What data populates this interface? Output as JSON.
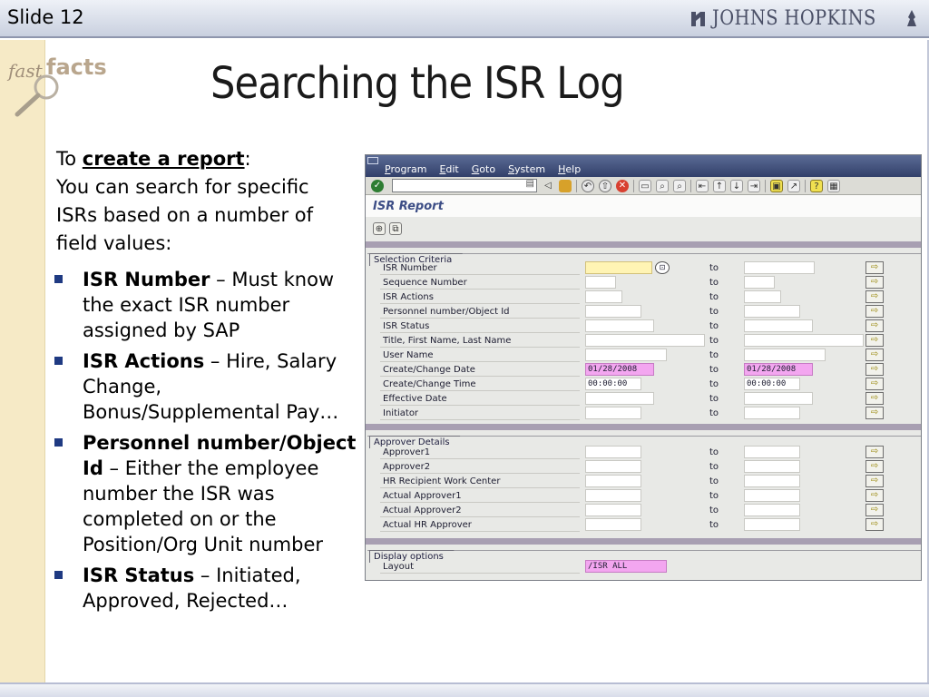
{
  "slide": {
    "label": "Slide 12",
    "title": "Searching the ISR Log"
  },
  "logos": {
    "institution": "JOHNS HOPKINS",
    "fast": "fast",
    "facts": "facts"
  },
  "intro": {
    "to": "To ",
    "link": "create a report",
    "colon": ":",
    "text": "You can search for specific ISRs based on a number of field values:"
  },
  "bullets": [
    {
      "bold": "ISR Number",
      "rest": " – Must know the exact ISR number assigned by SAP"
    },
    {
      "bold": "ISR Actions",
      "rest": " – Hire, Salary Change, Bonus/Supplemental Pay…"
    },
    {
      "bold": "Personnel number/Object Id",
      "rest": " – Either the employee number the ISR was completed on or the Position/Org Unit number"
    },
    {
      "bold": "ISR Status",
      "rest": " – Initiated, Approved, Rejected…"
    }
  ],
  "sap": {
    "menu": [
      "Program",
      "Edit",
      "Goto",
      "System",
      "Help"
    ],
    "app_title": "ISR Report",
    "groups": {
      "selection": "Selection Criteria",
      "approver": "Approver Details",
      "display": "Display options"
    },
    "to_label": "to",
    "selection_rows": [
      {
        "label": "ISR Number",
        "from": "",
        "to": "",
        "from_color": "yellow"
      },
      {
        "label": "Sequence Number",
        "from": "",
        "to": ""
      },
      {
        "label": "ISR Actions",
        "from": "",
        "to": ""
      },
      {
        "label": "Personnel number/Object Id",
        "from": "",
        "to": ""
      },
      {
        "label": "ISR Status",
        "from": "",
        "to": ""
      },
      {
        "label": "Title, First Name, Last Name",
        "from": "",
        "to": ""
      },
      {
        "label": "User Name",
        "from": "",
        "to": ""
      },
      {
        "label": "Create/Change Date",
        "from": "01/28/2008",
        "to": "01/28/2008",
        "from_color": "pink",
        "to_color": "pink"
      },
      {
        "label": "Create/Change Time",
        "from": "00:00:00",
        "to": "00:00:00"
      },
      {
        "label": "Effective Date",
        "from": "",
        "to": ""
      },
      {
        "label": "Initiator",
        "from": "",
        "to": ""
      }
    ],
    "approver_rows": [
      {
        "label": "Approver1",
        "from": "",
        "to": ""
      },
      {
        "label": "Approver2",
        "from": "",
        "to": ""
      },
      {
        "label": "HR Recipient Work Center",
        "from": "",
        "to": ""
      },
      {
        "label": "Actual Approver1",
        "from": "",
        "to": ""
      },
      {
        "label": "Actual Approver2",
        "from": "",
        "to": ""
      },
      {
        "label": "Actual HR Approver",
        "from": "",
        "to": ""
      }
    ],
    "layout": {
      "label": "Layout",
      "value": "/ISR ALL"
    }
  },
  "colors": {
    "accent_bar": "#a89fb2",
    "bullet": "#1f3a82",
    "stripe": "#f6eac6",
    "pink": "#f3a6f0"
  },
  "icons": [
    "checkmark-icon",
    "save-icon",
    "back-icon",
    "exit-icon",
    "cancel-icon",
    "print-icon",
    "find-icon",
    "help-icon",
    "execute-icon",
    "variant-icon",
    "arrow-right-icon"
  ]
}
